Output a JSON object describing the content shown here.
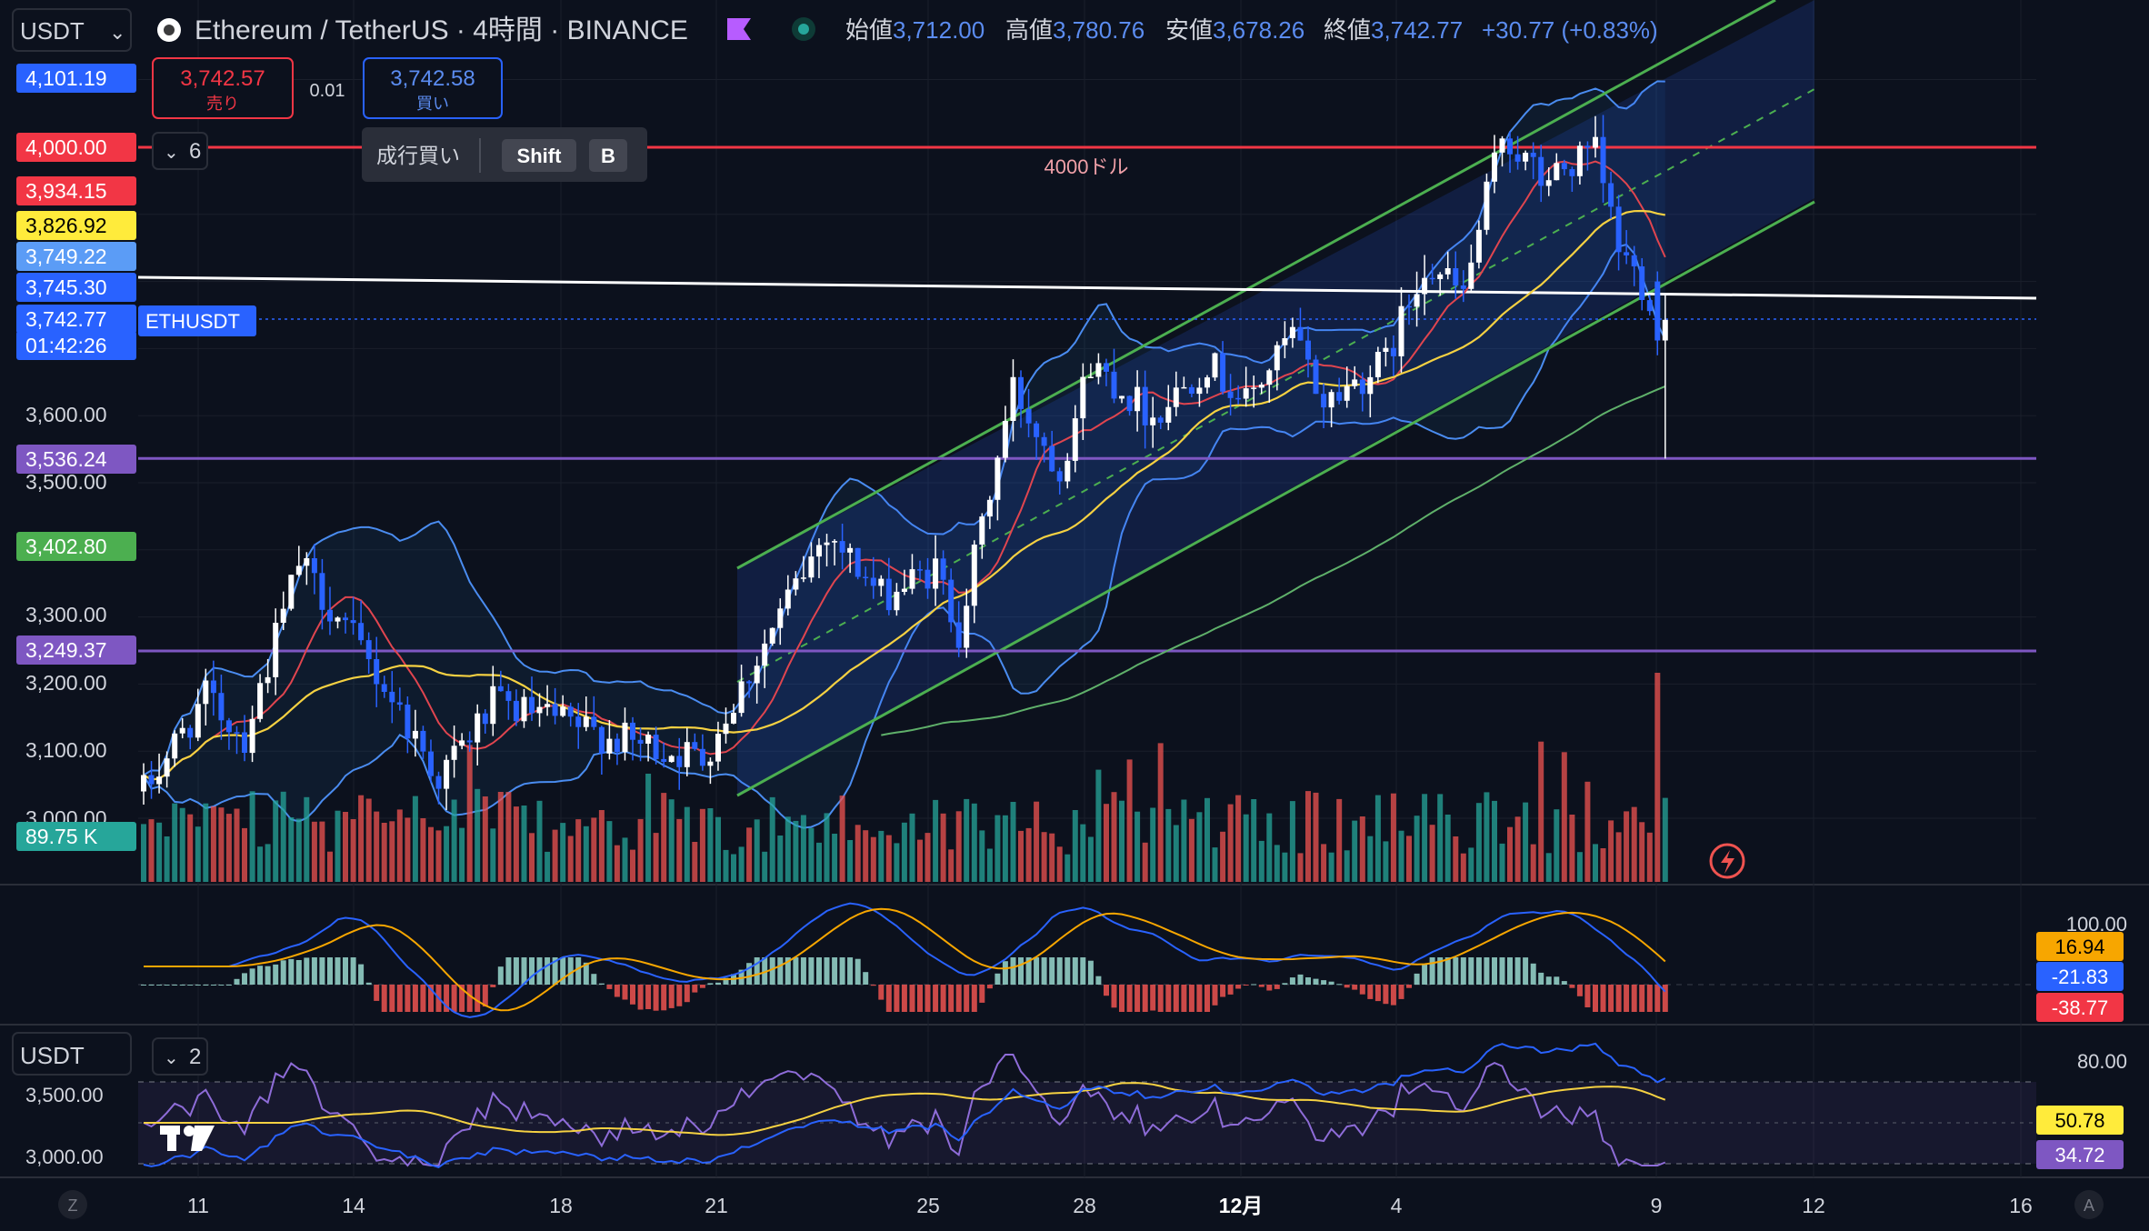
{
  "header": {
    "currency_selector": "USDT",
    "symbol_title": "Ethereum / TetherUS · 4時間 · BINANCE",
    "ohlc": {
      "open_label": "始値",
      "open": "3,712.00",
      "high_label": "高値",
      "high": "3,780.76",
      "low_label": "安値",
      "low": "3,678.26",
      "close_label": "終値",
      "close": "3,742.77",
      "change": "+30.77 (+0.83%)"
    }
  },
  "trade_panel": {
    "sell_price": "3,742.57",
    "sell_label": "売り",
    "spread": "0.01",
    "buy_price": "3,742.58",
    "buy_label": "買い",
    "tooltip_label": "成行買い",
    "shortcut_key1": "Shift",
    "shortcut_key2": "B",
    "collapse_count": "6"
  },
  "price_axis_labels": [
    {
      "text": "4,101.19",
      "bg": "#2962ff"
    },
    {
      "text": "4,000.00",
      "bg": "#f23645"
    },
    {
      "text": "3,934.15",
      "bg": "#f23645"
    },
    {
      "text": "3,826.92",
      "bg": "#ffeb3b"
    },
    {
      "text": "3,749.22",
      "bg": "#5b9cf6"
    },
    {
      "text": "3,745.30",
      "bg": "#2962ff"
    },
    {
      "text": "3,742.77",
      "bg": "#2962ff"
    },
    {
      "text": "01:42:26",
      "bg": "#2962ff"
    },
    {
      "text": "3,600.00",
      "bg": ""
    },
    {
      "text": "3,536.24",
      "bg": "#7e57c2"
    },
    {
      "text": "3,500.00",
      "bg": ""
    },
    {
      "text": "3,402.80",
      "bg": "#4caf50"
    },
    {
      "text": "3,300.00",
      "bg": ""
    },
    {
      "text": "3,249.37",
      "bg": "#7e57c2"
    },
    {
      "text": "3,200.00",
      "bg": ""
    },
    {
      "text": "3,100.00",
      "bg": ""
    },
    {
      "text": "3,000.00",
      "bg": ""
    },
    {
      "text": "89.75 K",
      "bg": "#26a69a"
    }
  ],
  "annotations": {
    "hline_4000_label": "4000ドル",
    "symbol_tag": "ETHUSDT"
  },
  "macd_axis": {
    "top": "100.00",
    "signal": "16.94",
    "macd": "-21.83",
    "hist": "-38.77"
  },
  "rsi_axis": {
    "currency_selector": "USDT",
    "collapse_count": "2",
    "left_ticks": [
      "3,500.00",
      "3,000.00"
    ],
    "right_top": "80.00",
    "signal": "50.78",
    "rsi": "34.72"
  },
  "time_axis": {
    "left_button": "Z",
    "right_button": "A",
    "ticks": [
      "11",
      "14",
      "18",
      "21",
      "25",
      "28",
      "12月",
      "4",
      "9",
      "12",
      "16"
    ]
  },
  "colors": {
    "up": "#ffffff",
    "down": "#2962ff",
    "vol_up": "#26a69a",
    "vol_down": "#ef5350",
    "channel": "#4caf50",
    "resistance": "#f23645",
    "support": "#7e57c2",
    "bollinger": "#4a8cf0",
    "ma_yellow": "#f5d142",
    "ma_red": "#e0454f"
  },
  "chart_data": {
    "type": "candlestick",
    "symbol": "ETHUSDT",
    "timeframe": "4h",
    "ylim": [
      2950,
      4130
    ],
    "x_ticks": [
      "11",
      "14",
      "18",
      "21",
      "25",
      "28",
      "12月",
      "4",
      "9",
      "12",
      "16"
    ],
    "horizontal_levels": [
      4000.0,
      3536.24,
      3249.37
    ],
    "price_path": [
      [
        0,
        3040
      ],
      [
        8,
        3180
      ],
      [
        13,
        3120
      ],
      [
        20,
        3380
      ],
      [
        25,
        3300
      ],
      [
        32,
        3180
      ],
      [
        38,
        3060
      ],
      [
        45,
        3170
      ],
      [
        52,
        3150
      ],
      [
        60,
        3120
      ],
      [
        72,
        3090
      ],
      [
        80,
        3260
      ],
      [
        88,
        3430
      ],
      [
        95,
        3330
      ],
      [
        102,
        3370
      ],
      [
        105,
        3280
      ],
      [
        112,
        3640
      ],
      [
        118,
        3520
      ],
      [
        122,
        3680
      ],
      [
        130,
        3600
      ],
      [
        137,
        3680
      ],
      [
        142,
        3620
      ],
      [
        148,
        3720
      ],
      [
        152,
        3620
      ],
      [
        160,
        3680
      ],
      [
        165,
        3830
      ],
      [
        170,
        3780
      ],
      [
        175,
        4020
      ],
      [
        180,
        3950
      ],
      [
        187,
        3990
      ],
      [
        190,
        3850
      ],
      [
        194,
        3780
      ],
      [
        196,
        3720
      ]
    ],
    "candle_count": 197,
    "last": {
      "open": 3712.0,
      "high": 3780.76,
      "low": 3678.26,
      "close": 3742.77
    }
  }
}
